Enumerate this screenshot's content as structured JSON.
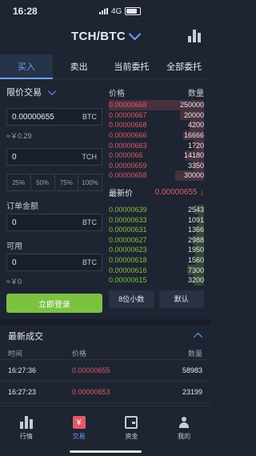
{
  "status_bar": {
    "time": "16:28",
    "network": "4G"
  },
  "header": {
    "pair": "TCH/BTC"
  },
  "tabs": [
    {
      "label": "买入",
      "active": true
    },
    {
      "label": "卖出",
      "active": false
    },
    {
      "label": "当前委托",
      "active": false
    },
    {
      "label": "全部委托",
      "active": false
    }
  ],
  "trade_form": {
    "order_type": "限价交易",
    "price_value": "0.00000655",
    "price_unit": "BTC",
    "price_cny": "≈￥0.29",
    "amount_value": "0",
    "amount_unit": "TCH",
    "percents": [
      "25%",
      "50%",
      "75%",
      "100%"
    ],
    "total_label": "订单金额",
    "total_value": "0",
    "total_unit": "BTC",
    "available_label": "可用",
    "available_value": "0",
    "available_unit": "BTC",
    "available_cny": "≈￥0",
    "login_button": "立即登录"
  },
  "order_book": {
    "price_header": "价格",
    "qty_header": "数量",
    "asks": [
      {
        "price": "0.00000668",
        "qty": "250000",
        "depth": 1.0
      },
      {
        "price": "0.00000667",
        "qty": "20000",
        "depth": 0.25
      },
      {
        "price": "0.00000668",
        "qty": "4200",
        "depth": 0.15
      },
      {
        "price": "0.00000666",
        "qty": "16666",
        "depth": 0.22
      },
      {
        "price": "0.00000663",
        "qty": "1720",
        "depth": 0.1
      },
      {
        "price": "0.0000066",
        "qty": "14180",
        "depth": 0.2
      },
      {
        "price": "0.00000659",
        "qty": "3350",
        "depth": 0.12
      },
      {
        "price": "0.00000658",
        "qty": "30000",
        "depth": 0.3
      }
    ],
    "latest_label": "最新价",
    "latest_price": "0.00000655",
    "bids": [
      {
        "price": "0.00000639",
        "qty": "2543",
        "depth": 0.1
      },
      {
        "price": "0.00000633",
        "qty": "1091",
        "depth": 0.06
      },
      {
        "price": "0.00000631",
        "qty": "1366",
        "depth": 0.08
      },
      {
        "price": "0.00000627",
        "qty": "2988",
        "depth": 0.12
      },
      {
        "price": "0.00000623",
        "qty": "1950",
        "depth": 0.09
      },
      {
        "price": "0.00000618",
        "qty": "1560",
        "depth": 0.09
      },
      {
        "price": "0.00000616",
        "qty": "7300",
        "depth": 0.18
      },
      {
        "price": "0.00000615",
        "qty": "3200",
        "depth": 0.11
      }
    ],
    "decimals_button": "8位小数",
    "default_button": "默认"
  },
  "recent_trades": {
    "title": "最新成交",
    "col_time": "时间",
    "col_price": "价格",
    "col_qty": "数量",
    "rows": [
      {
        "time": "16:27:36",
        "price": "0.00000655",
        "qty": "58983"
      },
      {
        "time": "16:27:23",
        "price": "0.00000653",
        "qty": "23199"
      }
    ]
  },
  "bottom_nav": [
    {
      "label": "行情",
      "icon": "market-icon",
      "active": false
    },
    {
      "label": "交易",
      "icon": "trade-icon",
      "active": true
    },
    {
      "label": "资金",
      "icon": "wallet-icon",
      "active": false
    },
    {
      "label": "我的",
      "icon": "user-icon",
      "active": false
    }
  ],
  "colors": {
    "accent": "#6ca0ff",
    "ask": "#e05a6a",
    "bid": "#7cc242",
    "background": "#1e2431"
  }
}
